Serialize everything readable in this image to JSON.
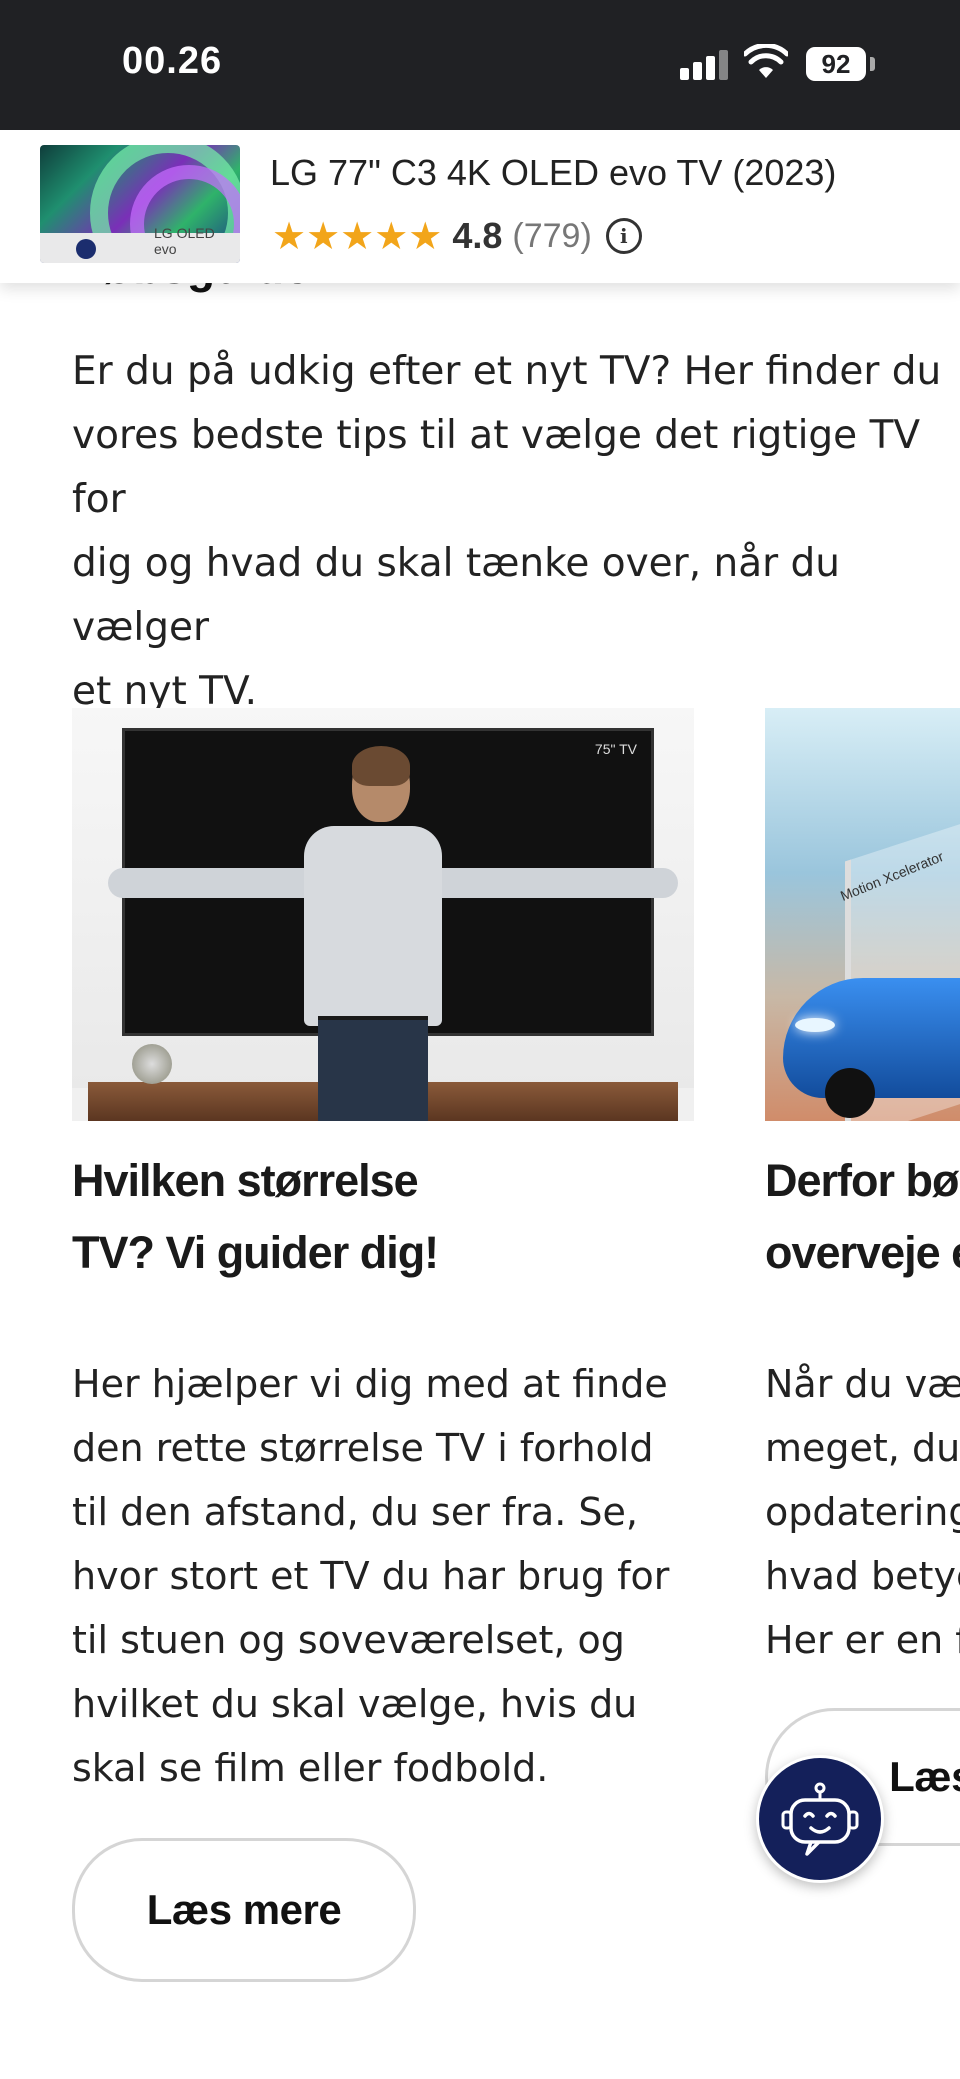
{
  "status_bar": {
    "time": "00.26",
    "battery": "92",
    "icons": [
      "cellular-signal-icon",
      "wifi-icon",
      "battery-icon"
    ]
  },
  "product_bar": {
    "title": "LG 77\" C3 4K OLED evo TV (2023)",
    "stars": "★★★★★",
    "rating_value": "4.8",
    "review_count": "(779)",
    "thumbnail_brand_text": "LG OLED evo",
    "info_icon_glyph": "i"
  },
  "page": {
    "section_heading": "Købsguide TV",
    "intro_lines": [
      "Er du på udkig efter et nyt TV? Her finder du",
      "vores bedste tips til at vælge det rigtige TV for",
      "dig og hvad du skal tænke over, når du vælger",
      "et nyt TV."
    ]
  },
  "cards": [
    {
      "image_label": "75\" TV",
      "title_lines": [
        "Hvilken størrelse",
        "TV? Vi guider dig!"
      ],
      "body_lines": [
        "Her hjælper vi dig med at finde",
        "den rette størrelse TV i forhold",
        "til den afstand, du ser fra. Se,",
        "hvor stort et TV du har brug for",
        "til stuen og soveværelset, og",
        "hvilket du skal vælge, hvis du",
        "skal se film eller fodbold."
      ],
      "button_label": "Læs mere"
    },
    {
      "image_label": "Motion Xcelerator",
      "title_lines": [
        "Derfor bør",
        "overveje e"
      ],
      "body_lines": [
        "Når du væ",
        "meget, du",
        "opdatering",
        "hvad betyc",
        "Her er en f"
      ],
      "button_label": "Læs m"
    }
  ],
  "chatbot": {
    "icon": "chatbot-icon"
  },
  "colors": {
    "status_bar_bg": "#202124",
    "star": "#f2a51a",
    "chatbot_bg": "#14205a"
  }
}
